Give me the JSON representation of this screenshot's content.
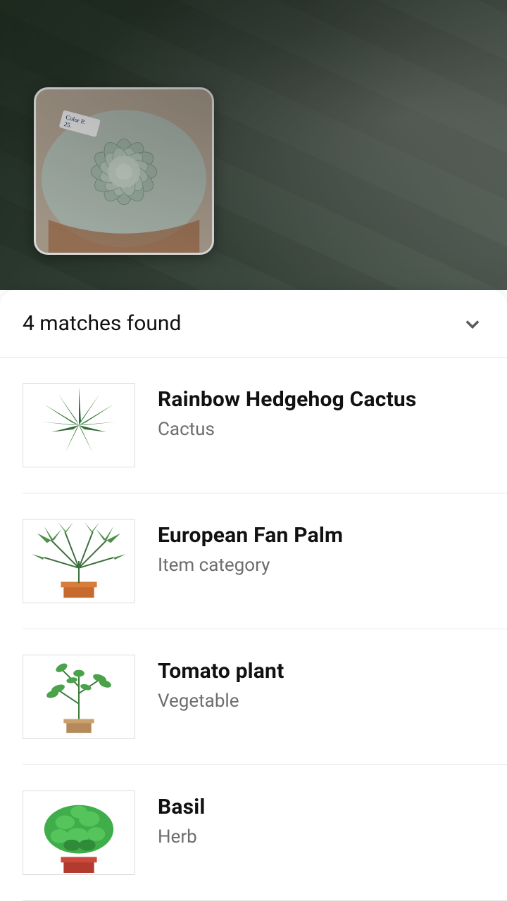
{
  "header": {
    "title": "4 matches found"
  },
  "results": [
    {
      "title": "Rainbow Hedgehog Cactus",
      "subtitle": "Cactus"
    },
    {
      "title": "European Fan Palm",
      "subtitle": "Item category"
    },
    {
      "title": "Tomato plant",
      "subtitle": "Vegetable"
    },
    {
      "title": "Basil",
      "subtitle": "Herb"
    }
  ],
  "icons": {
    "collapse": "chevron-down-icon"
  }
}
